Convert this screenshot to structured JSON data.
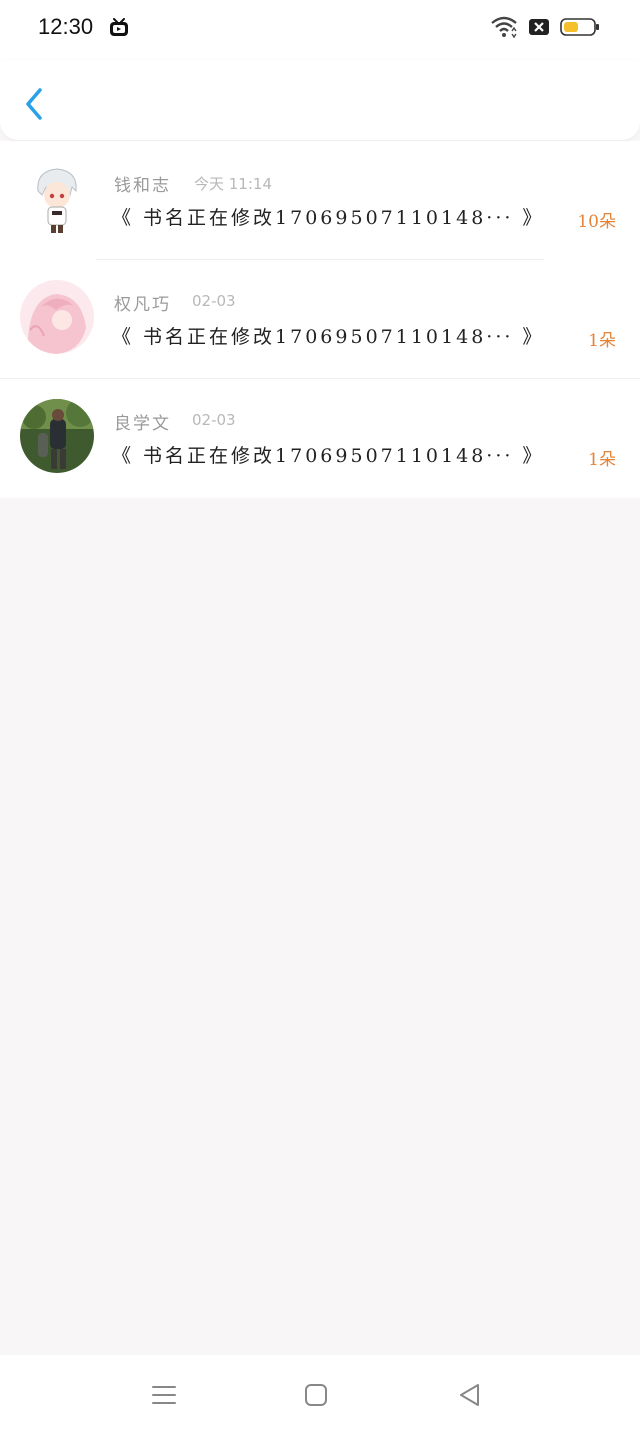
{
  "status": {
    "time": "12:30"
  },
  "header": {
    "back_icon": "chevron-left-icon",
    "accent": "#2aa0e6"
  },
  "messages": [
    {
      "name": "钱和志",
      "time": "今天 11:14",
      "title": "《 书名正在修改17069507110148··· 》",
      "count": "10朵"
    },
    {
      "name": "权凡巧",
      "time": "02-03",
      "title": "《 书名正在修改17069507110148··· 》",
      "count": "1朵"
    },
    {
      "name": "良学文",
      "time": "02-03",
      "title": "《 书名正在修改17069507110148··· 》",
      "count": "1朵"
    }
  ],
  "colors": {
    "count": "#e4843a",
    "background": "#f8f6f7"
  },
  "nav": {
    "menu_icon": "menu-icon",
    "home_icon": "square-home-icon",
    "back_icon": "triangle-back-icon"
  }
}
